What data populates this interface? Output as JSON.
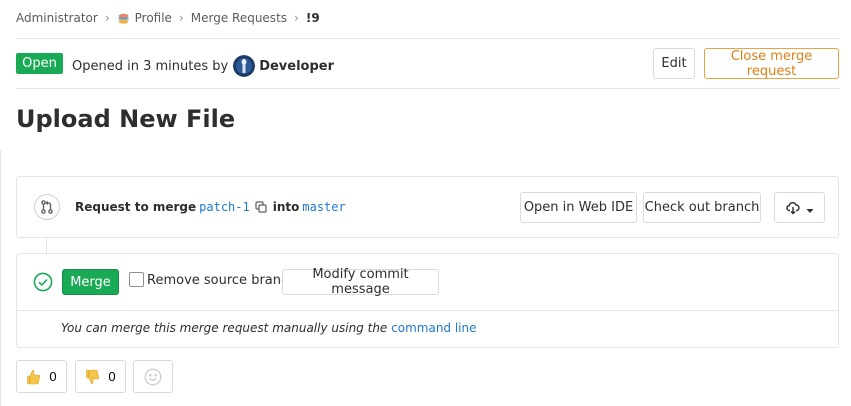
{
  "breadcrumb": {
    "items": [
      "Administrator",
      "Profile",
      "Merge Requests",
      "!9"
    ],
    "separator": "›"
  },
  "header": {
    "status": "Open",
    "opened_text": "Opened in 3 minutes by",
    "author": "Developer",
    "edit_label": "Edit",
    "close_label": "Close merge request"
  },
  "title": "Upload New File",
  "merge_info": {
    "request_to_merge": "Request to merge",
    "source_branch": "patch-1",
    "into": "into",
    "target_branch": "master",
    "open_ide_label": "Open in Web IDE",
    "checkout_label": "Check out branch"
  },
  "merge_widget": {
    "merge_label": "Merge",
    "remove_source_label": "Remove source branch",
    "remove_source_checked": false,
    "modify_commit_label": "Modify commit message",
    "manual_text": "You can merge this merge request manually using the",
    "command_line_link": "command line"
  },
  "awards": {
    "thumbsup_count": "0",
    "thumbsdown_count": "0"
  },
  "colors": {
    "success": "#1aaa55",
    "warning": "#e07e14",
    "link": "#1f78d1",
    "border": "#e5e5e5"
  },
  "icons": [
    "project-icon",
    "avatar-icon",
    "merge-request-icon",
    "copy-icon",
    "download-icon",
    "chevron-down-icon",
    "check-circle-icon",
    "thumbsup-icon",
    "thumbsdown-icon",
    "smiley-icon"
  ]
}
